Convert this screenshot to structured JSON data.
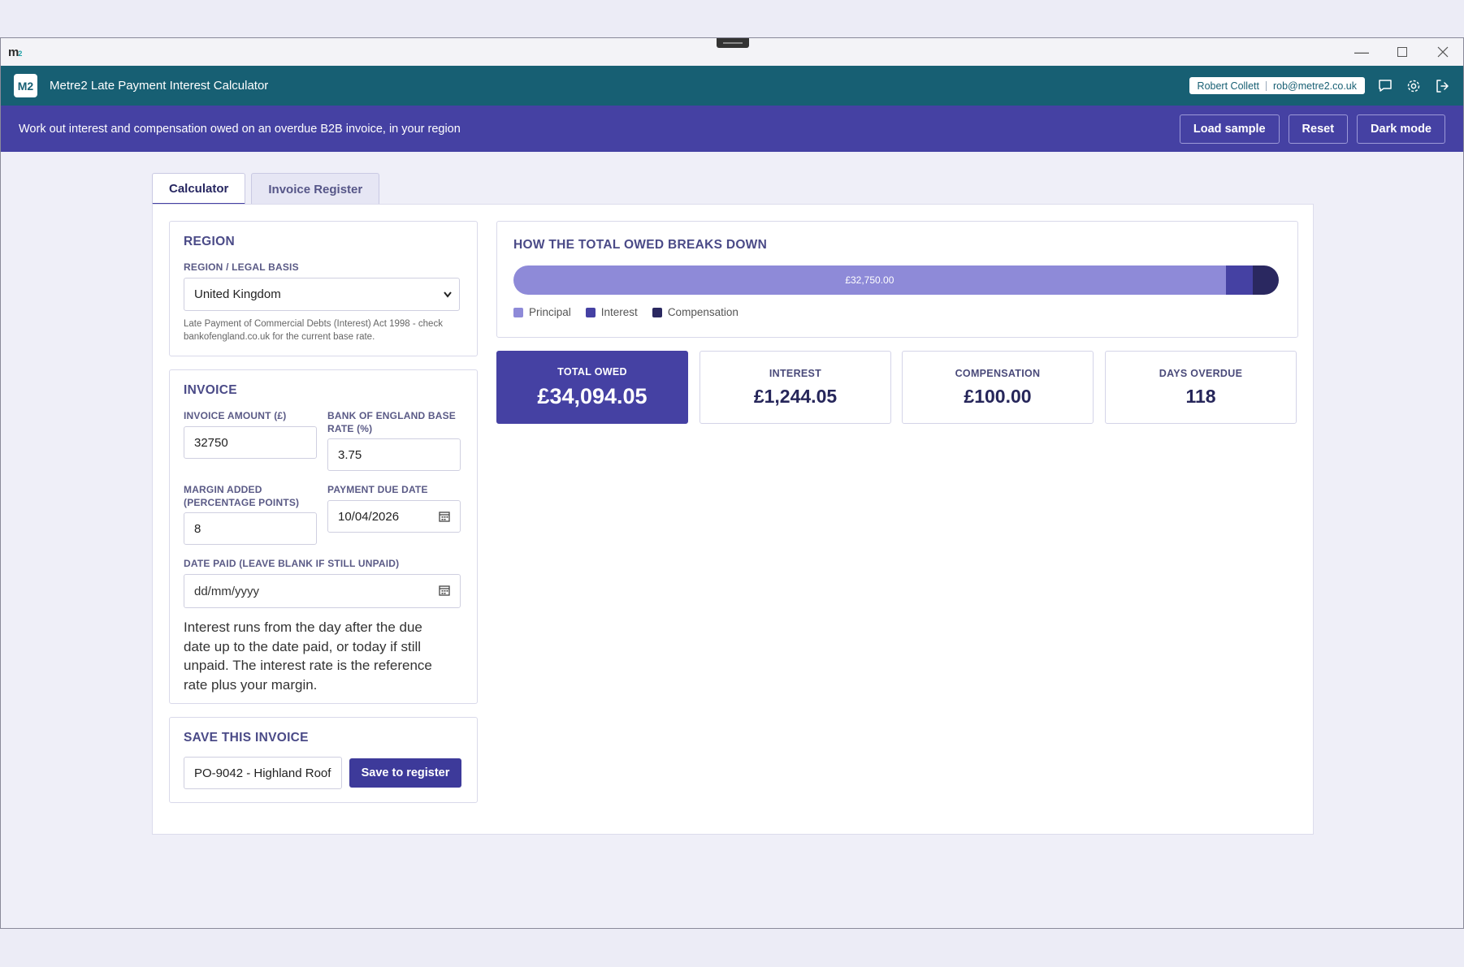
{
  "window": {
    "logo": "m",
    "logo_sub": "2"
  },
  "appbar": {
    "badge": "M2",
    "title": "Metre2 Late Payment Interest Calculator",
    "user_name": "Robert Collett",
    "user_email": "rob@metre2.co.uk",
    "icons": [
      "chat-icon",
      "gear-icon",
      "logout-icon"
    ]
  },
  "banner": {
    "text": "Work out interest and compensation owed on an overdue B2B invoice, in your region",
    "buttons": {
      "load_sample": "Load sample",
      "reset": "Reset",
      "dark_mode": "Dark mode"
    }
  },
  "tabs": [
    {
      "label": "Calculator",
      "active": true
    },
    {
      "label": "Invoice Register",
      "active": false
    }
  ],
  "region": {
    "title": "REGION",
    "label": "REGION / LEGAL BASIS",
    "selected": "United Kingdom",
    "note": "Late Payment of Commercial Debts (Interest) Act 1998 - check bankofengland.co.uk for the current base rate."
  },
  "invoice": {
    "title": "INVOICE",
    "amount_label": "INVOICE AMOUNT (£)",
    "amount_value": "32750",
    "base_rate_label": "BANK OF ENGLAND BASE RATE (%)",
    "base_rate_value": "3.75",
    "margin_label": "MARGIN ADDED (PERCENTAGE POINTS)",
    "margin_value": "8",
    "due_date_label": "PAYMENT DUE DATE",
    "due_date_value": "10/04/2026",
    "date_paid_label": "DATE PAID (LEAVE BLANK IF STILL UNPAID)",
    "date_paid_placeholder": "dd/mm/yyyy",
    "help": "Interest runs from the day after the due date up to the date paid, or today if still unpaid. The interest rate is the reference rate plus your margin."
  },
  "save": {
    "title": "SAVE THIS INVOICE",
    "name_value": "PO-9042 - Highland Roof",
    "button": "Save to register"
  },
  "breakdown": {
    "title": "HOW THE TOTAL OWED BREAKS DOWN",
    "principal_label": "£32,750.00",
    "legend": [
      "Principal",
      "Interest",
      "Compensation"
    ],
    "colors": {
      "principal": "#8e8ad8",
      "interest": "#4541a3",
      "compensation": "#2a2860"
    }
  },
  "chart_data": {
    "type": "bar",
    "title": "HOW THE TOTAL OWED BREAKS DOWN",
    "categories": [
      "Principal",
      "Interest",
      "Compensation"
    ],
    "values": [
      32750.0,
      1244.05,
      100.0
    ],
    "stacked": true,
    "orientation": "horizontal",
    "legend": "bottom-left"
  },
  "stats": {
    "total_label": "TOTAL OWED",
    "total_value": "£34,094.05",
    "interest_label": "INTEREST",
    "interest_value": "£1,244.05",
    "compensation_label": "COMPENSATION",
    "compensation_value": "£100.00",
    "days_label": "DAYS OVERDUE",
    "days_value": "118"
  }
}
